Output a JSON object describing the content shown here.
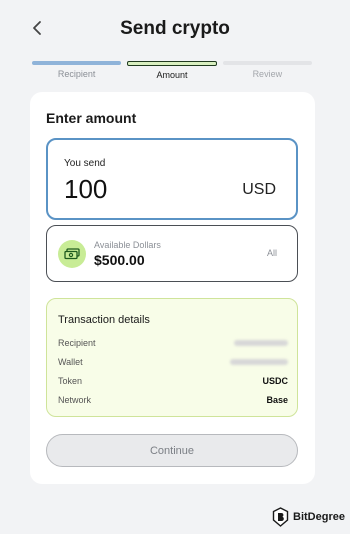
{
  "header": {
    "title": "Send crypto"
  },
  "steps": [
    {
      "label": "Recipient",
      "state": "done"
    },
    {
      "label": "Amount",
      "state": "active"
    },
    {
      "label": "Review",
      "state": "todo"
    }
  ],
  "card": {
    "title": "Enter amount",
    "send": {
      "label": "You send",
      "amount": "100",
      "currency": "USD"
    },
    "available": {
      "label": "Available Dollars",
      "value": "$500.00",
      "action": "All",
      "icon": "cash-icon"
    },
    "transaction": {
      "title": "Transaction details",
      "rows": [
        {
          "key": "Recipient",
          "value": "",
          "redacted": true
        },
        {
          "key": "Wallet",
          "value": "",
          "redacted": true
        },
        {
          "key": "Token",
          "value": "USDC"
        },
        {
          "key": "Network",
          "value": "Base"
        }
      ]
    },
    "continue_label": "Continue"
  },
  "brand": {
    "name": "BitDegree"
  },
  "colors": {
    "background": "#f2f3f5",
    "card": "#ffffff",
    "send_border": "#5a93c5",
    "step_done": "#8fb3d9",
    "step_active": "#d9efc0",
    "accent_green": "#c8ec96",
    "tx_background": "#f8fde8"
  }
}
